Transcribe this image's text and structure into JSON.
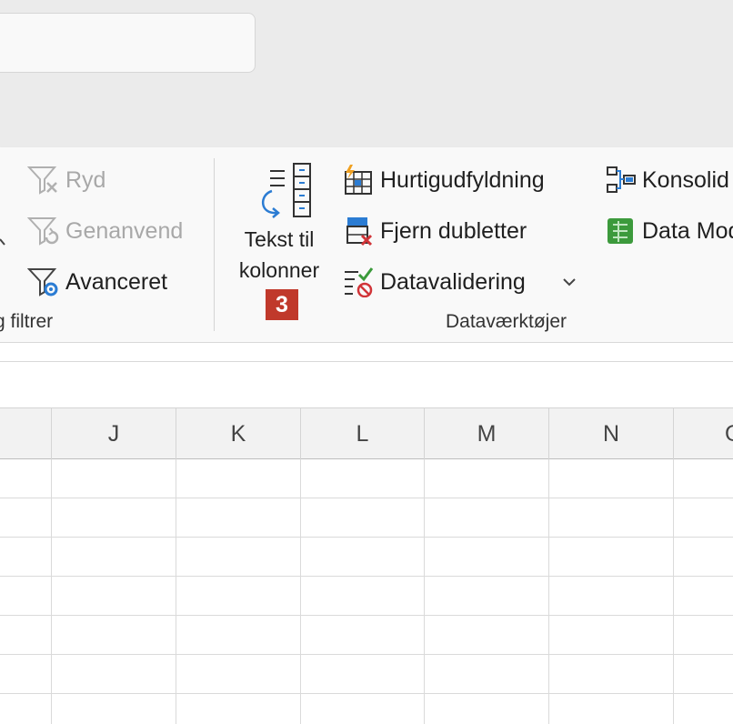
{
  "ribbon": {
    "sort_filter": {
      "clear_label": "Ryd",
      "reapply_label": "Genanvend",
      "advanced_label": "Avanceret",
      "group_label": "g filtrer"
    },
    "data_tools": {
      "text_to_columns_line1": "Tekst til",
      "text_to_columns_line2": "kolonner",
      "step_badge": "3",
      "flash_fill_label": "Hurtigudfyldning",
      "remove_duplicates_label": "Fjern dubletter",
      "data_validation_label": "Datavalidering",
      "consolidate_label": "Konsolid",
      "data_model_label": "Data Mod",
      "group_label": "Dataværktøjer"
    }
  },
  "grid": {
    "columns": [
      "J",
      "K",
      "L",
      "M",
      "N",
      "O"
    ]
  },
  "colors": {
    "badge": "#c0392b",
    "ribbon_bg": "#f9f9f9",
    "top_bg": "#ebebeb"
  }
}
